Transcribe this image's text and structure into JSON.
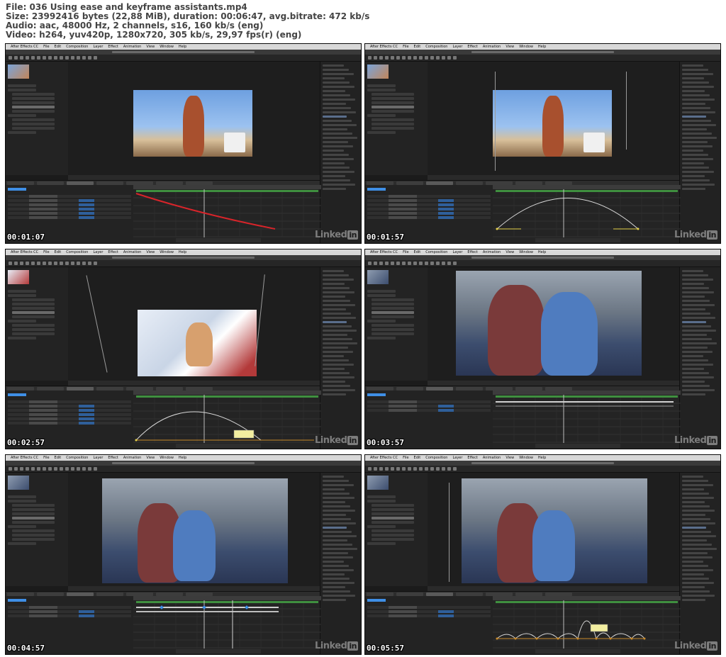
{
  "header": {
    "file_line": "File: 036 Using ease and keyframe assistants.mp4",
    "size_line": "Size: 23992416 bytes (22,88 MiB), duration: 00:06:47, avg.bitrate: 472 kb/s",
    "audio_line": "Audio: aac, 48000 Hz, 2 channels, s16, 160 kb/s (eng)",
    "video_line": "Video: h264, yuv420p, 1280x720, 305 kb/s, 29,97 fps(r) (eng)"
  },
  "app": {
    "menu": [
      "After Effects CC",
      "File",
      "Edit",
      "Composition",
      "Layer",
      "Effect",
      "Animation",
      "View",
      "Window",
      "Help"
    ]
  },
  "watermark": {
    "text": "Linked",
    "badge": "in"
  },
  "frames": [
    {
      "timestamp": "00:01:07",
      "scene": "man",
      "graph": "red-decline"
    },
    {
      "timestamp": "00:01:57",
      "scene": "man",
      "graph": "arc"
    },
    {
      "timestamp": "00:02:57",
      "scene": "boy",
      "graph": "arc-tooltip"
    },
    {
      "timestamp": "00:03:57",
      "scene": "people-large",
      "graph": "flat"
    },
    {
      "timestamp": "00:04:57",
      "scene": "people",
      "graph": "bars"
    },
    {
      "timestamp": "00:05:57",
      "scene": "people",
      "graph": "bumps"
    }
  ],
  "colors": {
    "timecode": "#3f8fe6",
    "graph_red": "#d8242a",
    "graph_white": "#d8d8d8",
    "keyframe_yellow": "#e6d24a",
    "speed_orange": "#c98a2a"
  }
}
